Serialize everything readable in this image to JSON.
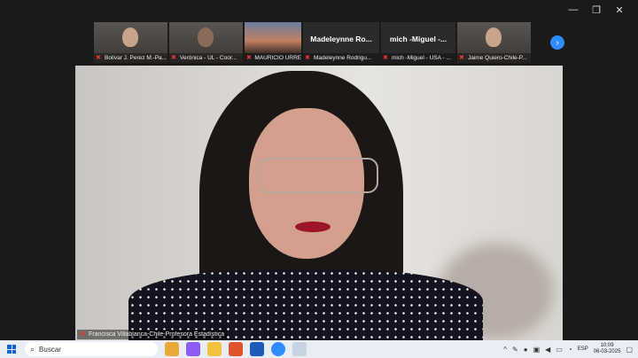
{
  "window": {
    "controls": [
      "—",
      "❐",
      "✕"
    ]
  },
  "gallery": {
    "tiles": [
      {
        "name": "Bolivar J. Perez M.-Pa...",
        "type": "video"
      },
      {
        "name": "Verónica - UL - Coor...",
        "type": "video"
      },
      {
        "name": "MAURICIO URREA",
        "type": "video"
      },
      {
        "name": "Madeleynne Rodrigu...",
        "big": "Madeleynne  Ro...",
        "type": "name"
      },
      {
        "name": "mich -Miguel - USA - ...",
        "big": "mich  -Miguel  -...",
        "type": "name"
      },
      {
        "name": "Jaime Quiero-Chile-P...",
        "type": "video"
      }
    ],
    "next_glyph": "›"
  },
  "main": {
    "speaker_name": "Francisca Villablanca-Chile-Profesora Estadística"
  },
  "taskbar": {
    "search_placeholder": "Buscar",
    "language": "ESP",
    "time": "10:09",
    "date": "06-03-2025"
  }
}
